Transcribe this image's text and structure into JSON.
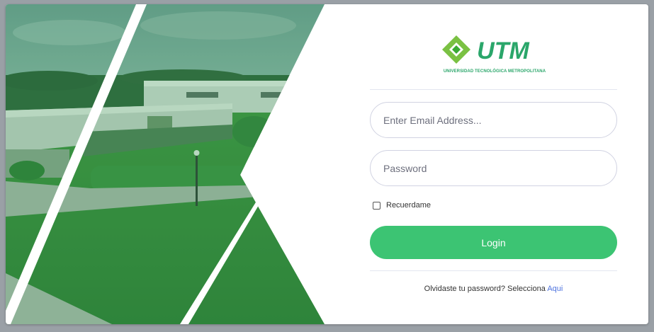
{
  "logo": {
    "wordmark": "UTM",
    "subtitle": "UNIVERSIDAD TECNOLÓGICA METROPOLITANA",
    "brand_color": "#2aa66a"
  },
  "login_form": {
    "email_placeholder": "Enter Email Address...",
    "email_value": "",
    "password_placeholder": "Password",
    "password_value": "",
    "remember_label": "Recuerdame",
    "remember_checked": false,
    "login_button_label": "Login",
    "forgot_text": "Olvidaste tu password? Selecciona",
    "forgot_link": "Aqui"
  },
  "colors": {
    "primary_green": "#3cc473",
    "link_blue": "#4e73df",
    "backdrop": "#9aa0a6"
  }
}
